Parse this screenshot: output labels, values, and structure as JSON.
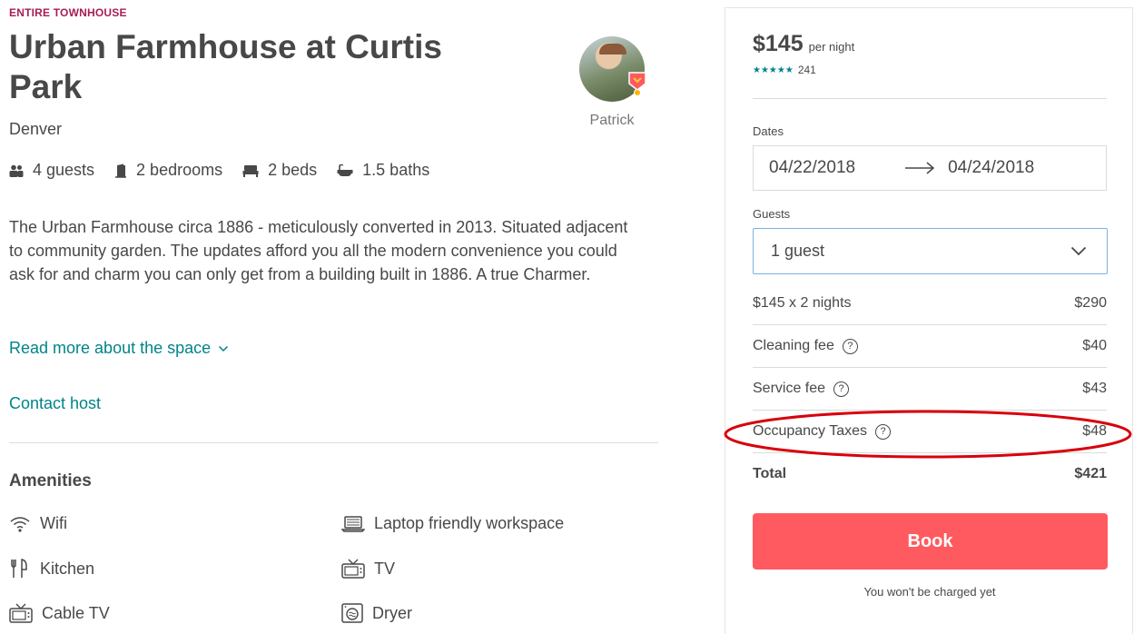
{
  "listing": {
    "kicker": "ENTIRE TOWNHOUSE",
    "title": "Urban Farmhouse at Curtis Park",
    "city": "Denver",
    "host_name": "Patrick",
    "facts": {
      "guests": "4 guests",
      "bedrooms": "2 bedrooms",
      "beds": "2 beds",
      "baths": "1.5 baths"
    },
    "description": "The Urban Farmhouse circa 1886 - meticulously converted in 2013. Situated adjacent to community garden. The updates afford you all the modern convenience you could ask for and charm you can only get from a building built in 1886. A true Charmer.",
    "read_more": "Read more about the space",
    "contact": "Contact host"
  },
  "amenities": {
    "heading": "Amenities",
    "items": [
      "Wifi",
      "Laptop friendly workspace",
      "Kitchen",
      "TV",
      "Cable TV",
      "Dryer"
    ]
  },
  "booking": {
    "price": "$145",
    "per_night": "per night",
    "stars": "★★★★★",
    "review_count": "241",
    "dates_label": "Dates",
    "check_in": "04/22/2018",
    "check_out": "04/24/2018",
    "guests_label": "Guests",
    "guests_value": "1 guest",
    "lines": [
      {
        "label": "$145 x 2 nights",
        "amount": "$290"
      },
      {
        "label": "Cleaning fee",
        "amount": "$40"
      },
      {
        "label": "Service fee",
        "amount": "$43"
      },
      {
        "label": "Occupancy Taxes",
        "amount": "$48"
      }
    ],
    "help_glyph": "?",
    "total_label": "Total",
    "total_amount": "$421",
    "book_label": "Book",
    "note": "You won't be charged yet"
  },
  "colors": {
    "accent_teal": "#008489",
    "book_button": "#ff5a5f",
    "kicker": "#a61d55",
    "annotation_red": "#d8000c"
  }
}
